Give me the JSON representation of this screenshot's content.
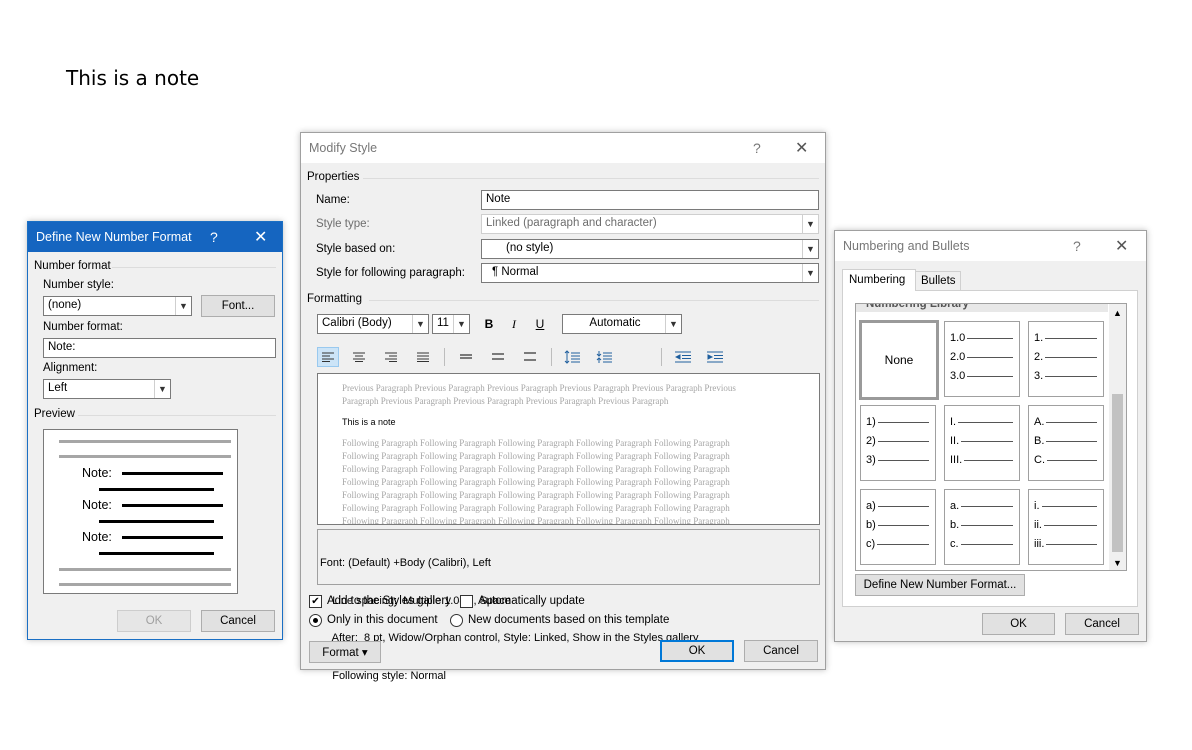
{
  "document": {
    "note_text": "This is a note"
  },
  "define_dialog": {
    "title": "Define New Number Format",
    "help": "?",
    "close": "✕",
    "number_format_section": "Number format",
    "number_style_label": "Number style:",
    "number_style_value": "(none)",
    "font_button": "Font...",
    "number_format_label": "Number format:",
    "number_format_value": "Note:",
    "alignment_label": "Alignment:",
    "alignment_value": "Left",
    "preview_section": "Preview",
    "preview_items": [
      "Note:",
      "Note:",
      "Note:"
    ],
    "ok": "OK",
    "cancel": "Cancel"
  },
  "modify_dialog": {
    "title": "Modify Style",
    "help": "?",
    "close": "✕",
    "properties_section": "Properties",
    "name_label": "Name:",
    "name_value": "Note",
    "style_type_label": "Style type:",
    "style_type_value": "Linked (paragraph and character)",
    "based_on_label": "Style based on:",
    "based_on_value": "(no style)",
    "following_label": "Style for following paragraph:",
    "following_value": "¶  Normal",
    "formatting_section": "Formatting",
    "font_name": "Calibri (Body)",
    "font_size": "11",
    "bold": "B",
    "italic": "I",
    "underline": "U",
    "color": "Automatic",
    "preview_previous": "Previous Paragraph Previous Paragraph Previous Paragraph Previous Paragraph Previous Paragraph Previous Paragraph Previous Paragraph Previous Paragraph Previous Paragraph Previous Paragraph",
    "preview_sample": "This is a note",
    "preview_following": "Following Paragraph Following Paragraph Following Paragraph Following Paragraph Following Paragraph Following Paragraph Following Paragraph Following Paragraph Following Paragraph Following Paragraph Following Paragraph Following Paragraph Following Paragraph Following Paragraph Following Paragraph Following Paragraph Following Paragraph Following Paragraph Following Paragraph Following Paragraph Following Paragraph Following Paragraph Following Paragraph Following Paragraph Following Paragraph Following Paragraph Following Paragraph Following Paragraph Following Paragraph Following Paragraph Following Paragraph Following Paragraph Following Paragraph Following Paragraph Following Paragraph Following Paragraph Following Paragraph Following Paragraph Following Paragraph Following Paragraph",
    "desc_lines": [
      "Font: (Default) +Body (Calibri), Left",
      "    Line spacing:  Multiple 1.08 li, Space",
      "    After:  8 pt, Widow/Orphan control, Style: Linked, Show in the Styles gallery",
      "    Following style: Normal"
    ],
    "add_gallery": "Add to the Styles gallery",
    "auto_update": "Automatically update",
    "only_doc": "Only in this document",
    "new_docs": "New documents based on this template",
    "format_button": "Format ▾",
    "ok": "OK",
    "cancel": "Cancel"
  },
  "bullets_dialog": {
    "title": "Numbering and Bullets",
    "help": "?",
    "close": "✕",
    "tab_numbering": "Numbering",
    "tab_bullets": "Bullets",
    "library_label": "Numbering Library",
    "none_label": "None",
    "cells": [
      [
        "1.0",
        "2.0",
        "3.0"
      ],
      [
        "1.",
        "2.",
        "3."
      ],
      [
        "1)",
        "2)",
        "3)"
      ],
      [
        "I.",
        "II.",
        "III."
      ],
      [
        "A.",
        "B.",
        "C."
      ],
      [
        "a)",
        "b)",
        "c)"
      ],
      [
        "a.",
        "b.",
        "c."
      ],
      [
        "i.",
        "ii.",
        "iii."
      ]
    ],
    "define_button": "Define New Number Format...",
    "ok": "OK",
    "cancel": "Cancel"
  }
}
